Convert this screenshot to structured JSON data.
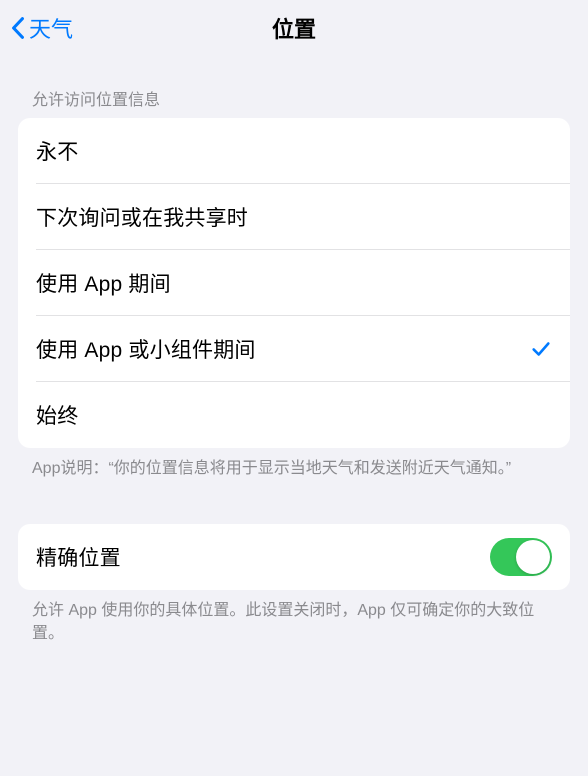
{
  "header": {
    "back_label": "天气",
    "title": "位置"
  },
  "access_section": {
    "header": "允许访问位置信息",
    "options": [
      {
        "label": "永不",
        "selected": false
      },
      {
        "label": "下次询问或在我共享时",
        "selected": false
      },
      {
        "label": "使用 App 期间",
        "selected": false
      },
      {
        "label": "使用 App 或小组件期间",
        "selected": true
      },
      {
        "label": "始终",
        "selected": false
      }
    ],
    "footer": "App说明：“你的位置信息将用于显示当地天气和发送附近天气通知。”"
  },
  "precise_section": {
    "label": "精确位置",
    "enabled": true,
    "footer": "允许 App 使用你的具体位置。此设置关闭时，App 仅可确定你的大致位置。"
  }
}
